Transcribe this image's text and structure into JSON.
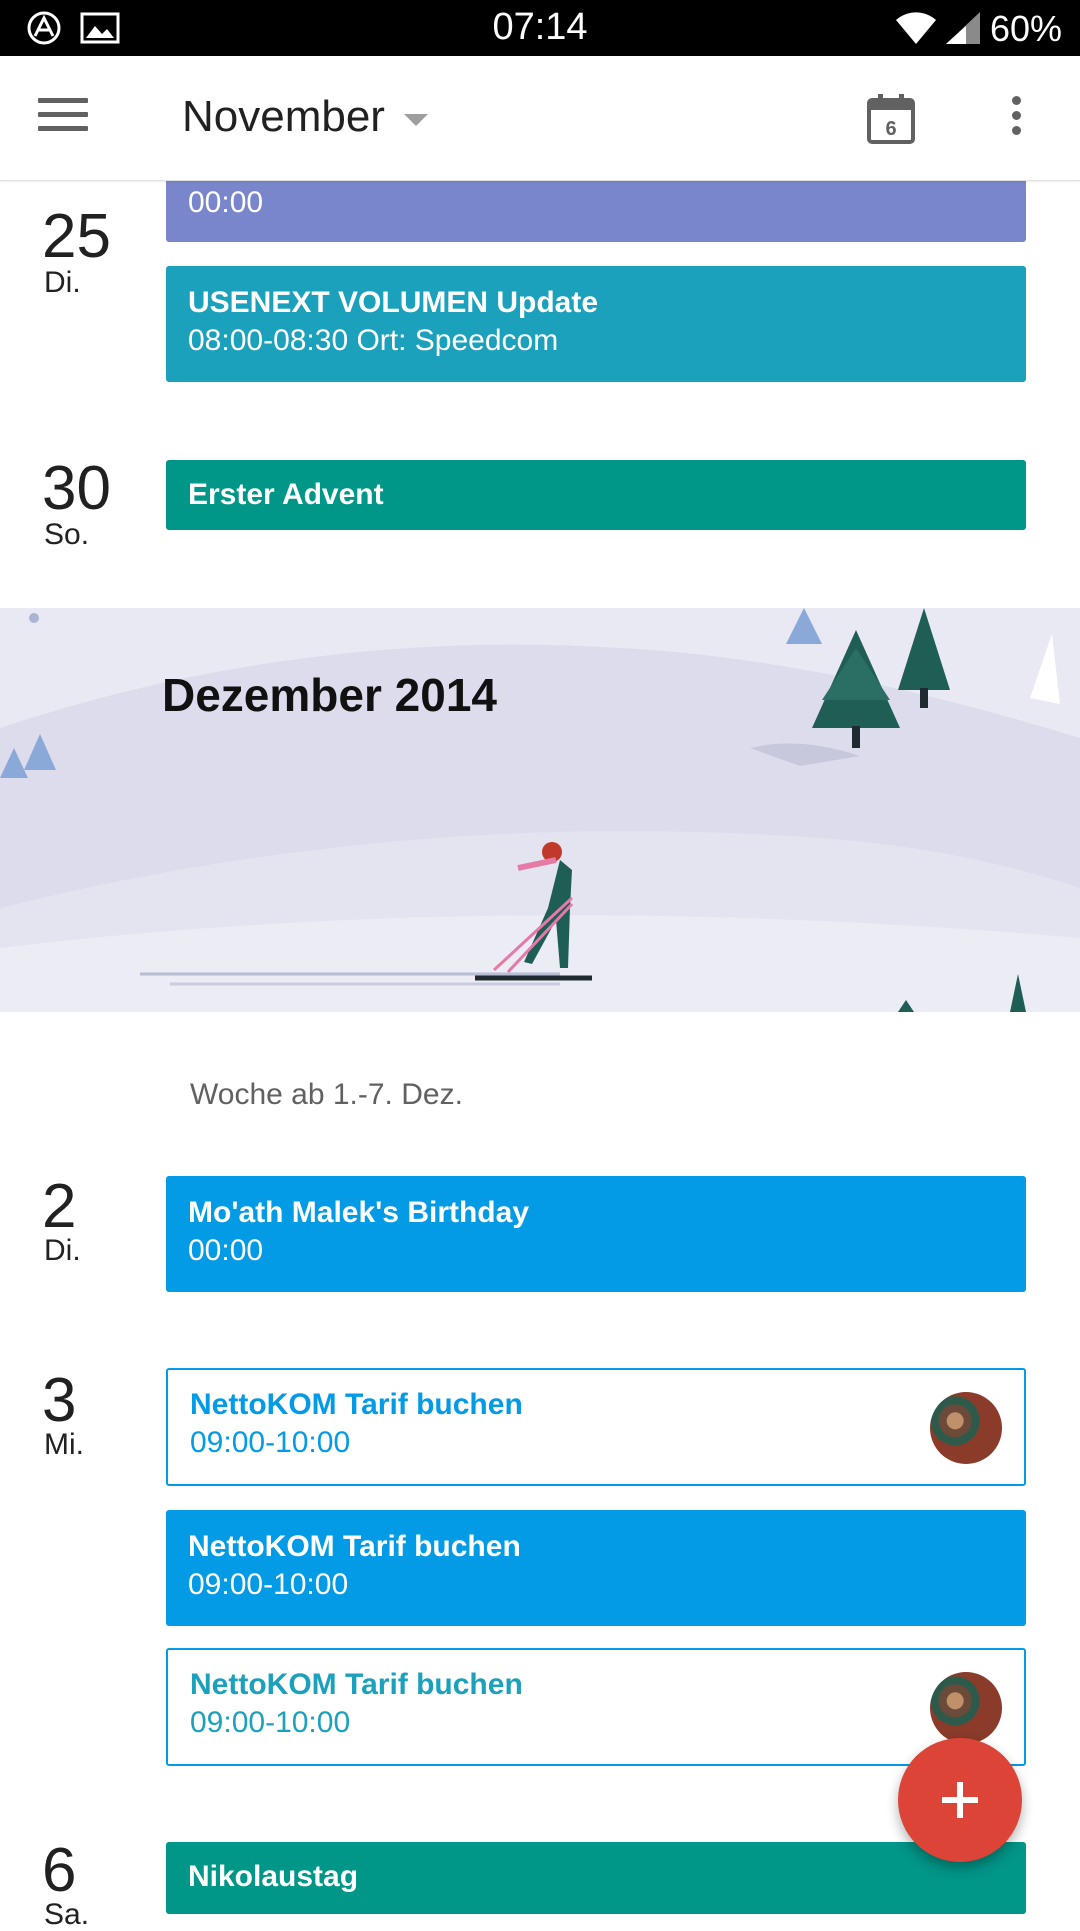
{
  "statusbar": {
    "time": "07:14",
    "battery": "60%"
  },
  "appbar": {
    "month": "November",
    "today_day": "6"
  },
  "days": [
    {
      "num": "25",
      "name": "Di."
    },
    {
      "num": "30",
      "name": "So."
    },
    {
      "num": "2",
      "name": "Di."
    },
    {
      "num": "3",
      "name": "Mi."
    },
    {
      "num": "6",
      "name": "Sa."
    }
  ],
  "events": [
    {
      "title": "",
      "sub": "00:00"
    },
    {
      "title": "USENEXT VOLUMEN Update",
      "sub": "08:00-08:30 Ort: Speedcom"
    },
    {
      "title": "Erster Advent",
      "sub": ""
    },
    {
      "title": "Mo'ath Malek's Birthday",
      "sub": "00:00"
    },
    {
      "title": "NettoKOM Tarif buchen",
      "sub": "09:00-10:00"
    },
    {
      "title": "NettoKOM Tarif buchen",
      "sub": "09:00-10:00"
    },
    {
      "title": "NettoKOM Tarif buchen",
      "sub": "09:00-10:00"
    },
    {
      "title": "Nikolaustag",
      "sub": ""
    }
  ],
  "banner": {
    "title": "Dezember 2014"
  },
  "week_label": "Woche ab 1.-7. Dez.",
  "colors": {
    "purple": "#7986cb",
    "teal_blue": "#1ba1bc",
    "green": "#009688",
    "blue": "#039be5",
    "fab": "#db4437"
  },
  "icons": [
    "menu-icon",
    "dropdown-caret-icon",
    "calendar-today-icon",
    "more-vert-icon",
    "add-icon",
    "wifi-icon",
    "signal-icon"
  ]
}
